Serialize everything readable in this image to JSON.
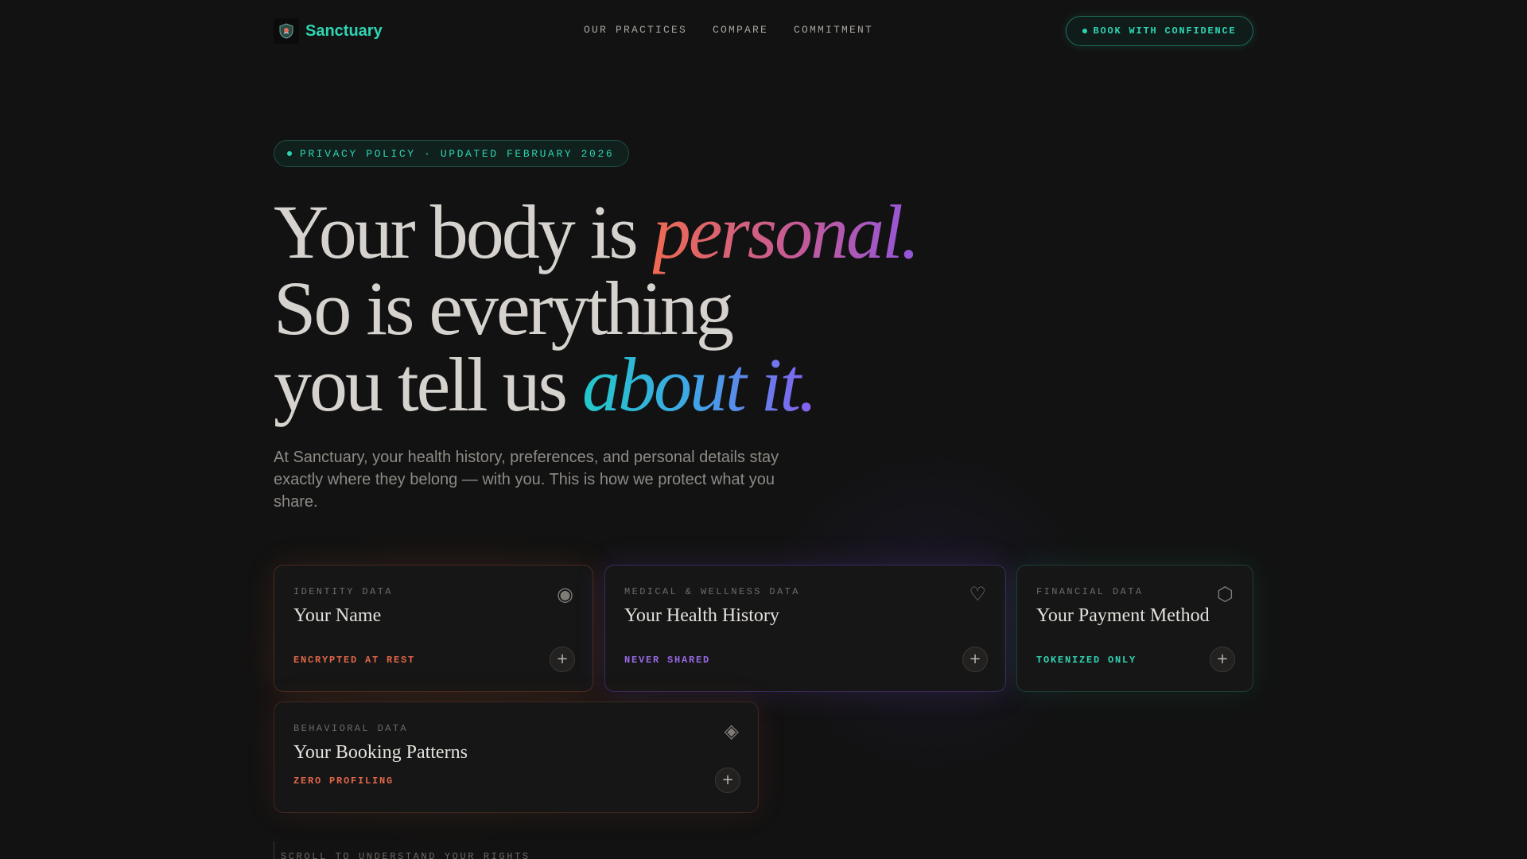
{
  "nav": {
    "brand": "Sanctuary",
    "links": [
      "OUR PRACTICES",
      "COMPARE",
      "COMMITMENT"
    ],
    "cta_label": "BOOK WITH CONFIDENCE"
  },
  "badge": {
    "text": "PRIVACY POLICY · UPDATED FEBRUARY 2026"
  },
  "hero": {
    "line1_plain": "Your body is ",
    "line1_accent": "personal.",
    "line2": "So is everything",
    "line3_plain": "you tell us ",
    "line3_accent": "about it."
  },
  "subtitle": "At Sanctuary, your health history, preferences, and personal details stay exactly where they belong — with you. This is how we protect what you share.",
  "cards": [
    {
      "category": "IDENTITY DATA",
      "title": "Your Name",
      "tag": "ENCRYPTED AT REST",
      "tag_color": "#e0674a",
      "icon": "target-icon",
      "glyph": "◉"
    },
    {
      "category": "MEDICAL & WELLNESS DATA",
      "title": "Your Health History",
      "tag": "NEVER SHARED",
      "tag_color": "#9a6ae6",
      "icon": "heart-icon",
      "glyph": "♡"
    },
    {
      "category": "FINANCIAL DATA",
      "title": "Your Payment Method",
      "tag": "TOKENIZED ONLY",
      "tag_color": "#2fd4b3",
      "icon": "hexagon-icon",
      "glyph": "⬡"
    },
    {
      "category": "BEHAVIORAL DATA",
      "title": "Your Booking Patterns",
      "tag": "ZERO PROFILING",
      "tag_color": "#e0674a",
      "icon": "diamond-icon",
      "glyph": "◈"
    }
  ],
  "expand_glyph": "+",
  "scroll_hint": "SCROLL TO UNDERSTAND YOUR RIGHTS",
  "colors": {
    "background": "#121212",
    "accent_teal": "#2fd4b3",
    "accent_coral": "#e0674a",
    "accent_violet": "#9a6ae6"
  }
}
